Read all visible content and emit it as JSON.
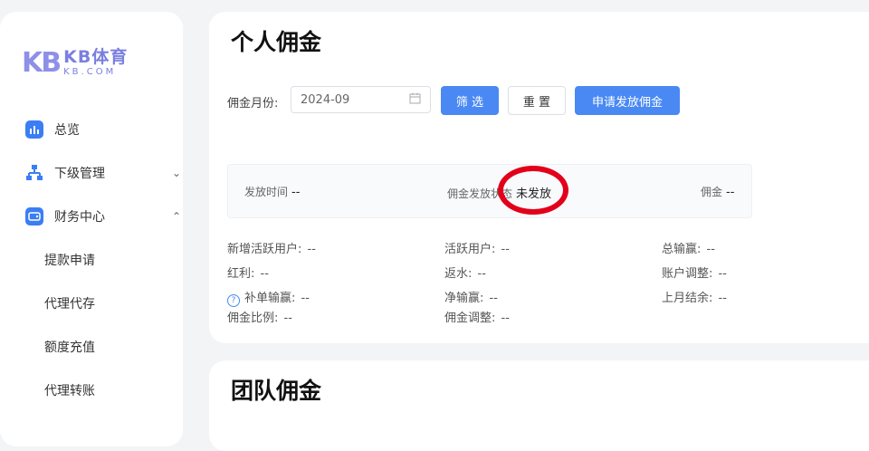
{
  "brand": {
    "mark": "KB",
    "name": "KB体育",
    "domain": "KB.COM",
    "color": "#7a7fe0"
  },
  "sidebar": {
    "items": [
      {
        "label": "总览",
        "icon": "chart-icon"
      },
      {
        "label": "下级管理",
        "icon": "hierarchy-icon",
        "chevron": "⌄"
      },
      {
        "label": "财务中心",
        "icon": "wallet-icon",
        "chevron": "⌃"
      }
    ],
    "sub_items": [
      "提款申请",
      "代理代存",
      "额度充值",
      "代理转账"
    ]
  },
  "personal": {
    "title": "个人佣金",
    "filter": {
      "label": "佣金月份:",
      "date_value": "2024-09",
      "search_label": "筛 选",
      "reset_label": "重 置",
      "apply_label": "申请发放佣金"
    },
    "status": {
      "time_label": "发放时间",
      "time_value": "--",
      "state_label": "佣金发放状态",
      "state_value": "未发放",
      "commission_label": "佣金",
      "commission_value": "--"
    },
    "stats": {
      "new_active_label": "新增活跃用户:",
      "new_active_value": "--",
      "active_label": "活跃用户:",
      "active_value": "--",
      "total_wl_label": "总输赢:",
      "total_wl_value": "--",
      "bonus_label": "红利:",
      "bonus_value": "--",
      "rebate_label": "返水:",
      "rebate_value": "--",
      "account_adj_label": "账户调整:",
      "account_adj_value": "--",
      "supp_wl_label": "补单输赢:",
      "supp_wl_value": "--",
      "net_wl_label": "净输赢:",
      "net_wl_value": "--",
      "last_balance_label": "上月结余:",
      "last_balance_value": "--",
      "ratio_label": "佣金比例:",
      "ratio_value": "--",
      "comm_adj_label": "佣金调整:",
      "comm_adj_value": "--"
    }
  },
  "team": {
    "title": "团队佣金"
  },
  "colors": {
    "primary": "#4a89f3",
    "annotation": "#e2001a"
  }
}
